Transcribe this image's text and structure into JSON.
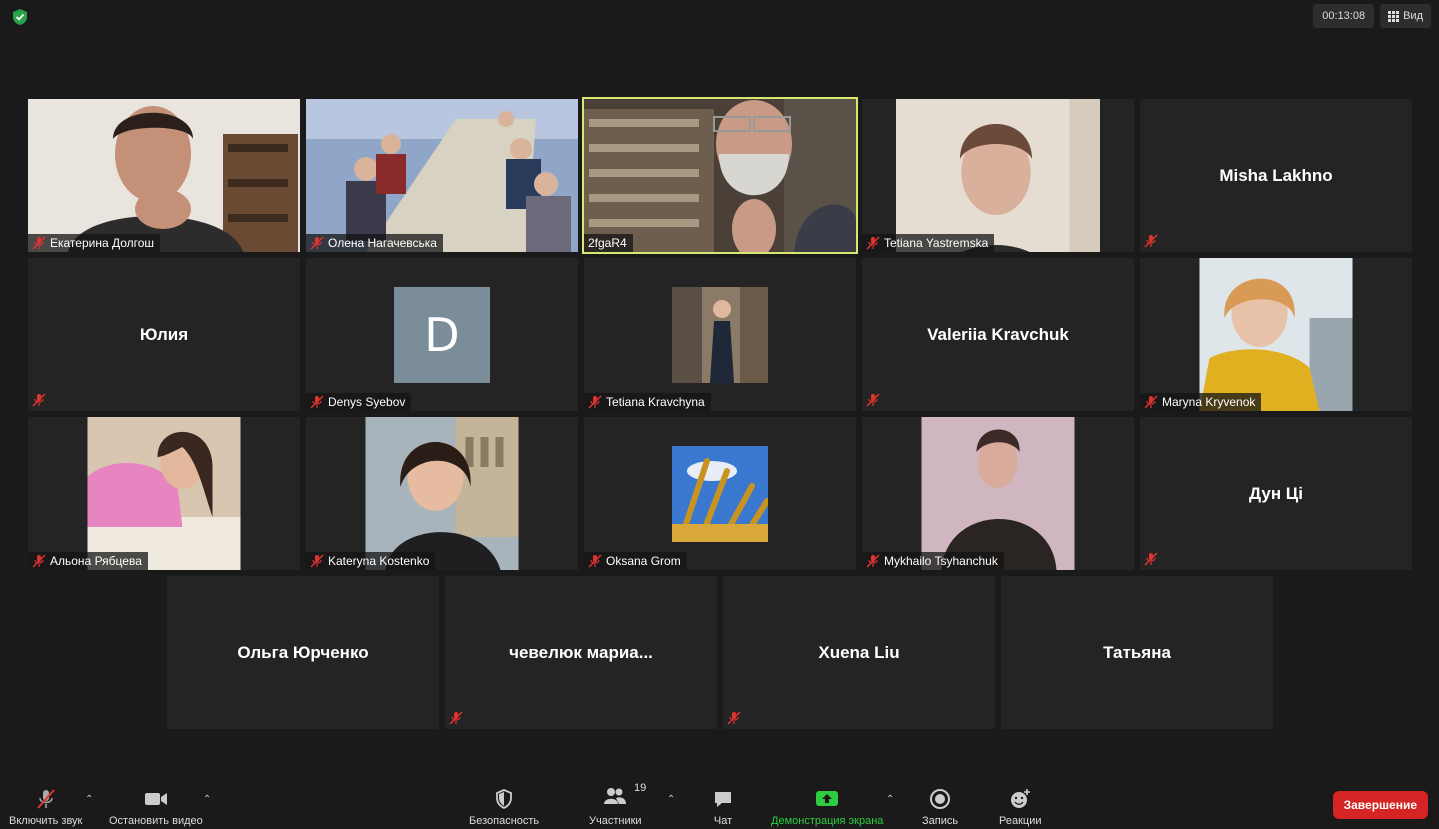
{
  "header": {
    "timer": "00:13:08",
    "view_label": "Вид"
  },
  "tiles": [
    {
      "name": "Екатерина Долгош"
    },
    {
      "name": "Олена Нагачевська"
    },
    {
      "name": "2fgaR4"
    },
    {
      "name": "Tetiana Yastremska"
    },
    {
      "name": "Misha Lakhno"
    },
    {
      "name": "Юлия"
    },
    {
      "name": "Denys Syebov",
      "initial": "D"
    },
    {
      "name": "Tetiana Kravchyna"
    },
    {
      "name": "Valeriia Kravchuk"
    },
    {
      "name": "Maryna Kryvenok"
    },
    {
      "name": "Альона Рябцева"
    },
    {
      "name": "Kateryna Kostenko"
    },
    {
      "name": "Oksana Grom"
    },
    {
      "name": "Mykhailo Tsyhanchuk"
    },
    {
      "name": "Дун Ці"
    },
    {
      "name": "Ольга Юрченко"
    },
    {
      "name": "чевелюк  мариа..."
    },
    {
      "name": "Xuena Liu"
    },
    {
      "name": "Татьяна"
    }
  ],
  "toolbar": {
    "unmute": "Включить звук",
    "stop_video": "Остановить видео",
    "security": "Безопасность",
    "participants": "Участники",
    "participants_count": "19",
    "chat": "Чат",
    "share_screen": "Демонстрация экрана",
    "record": "Запись",
    "reactions": "Реакции",
    "end": "Завершение"
  },
  "colors": {
    "active_speaker": "#d5e86f",
    "end_button": "#d42424",
    "share_green": "#2ecc40",
    "avatar_bg": "#7b8d98"
  }
}
